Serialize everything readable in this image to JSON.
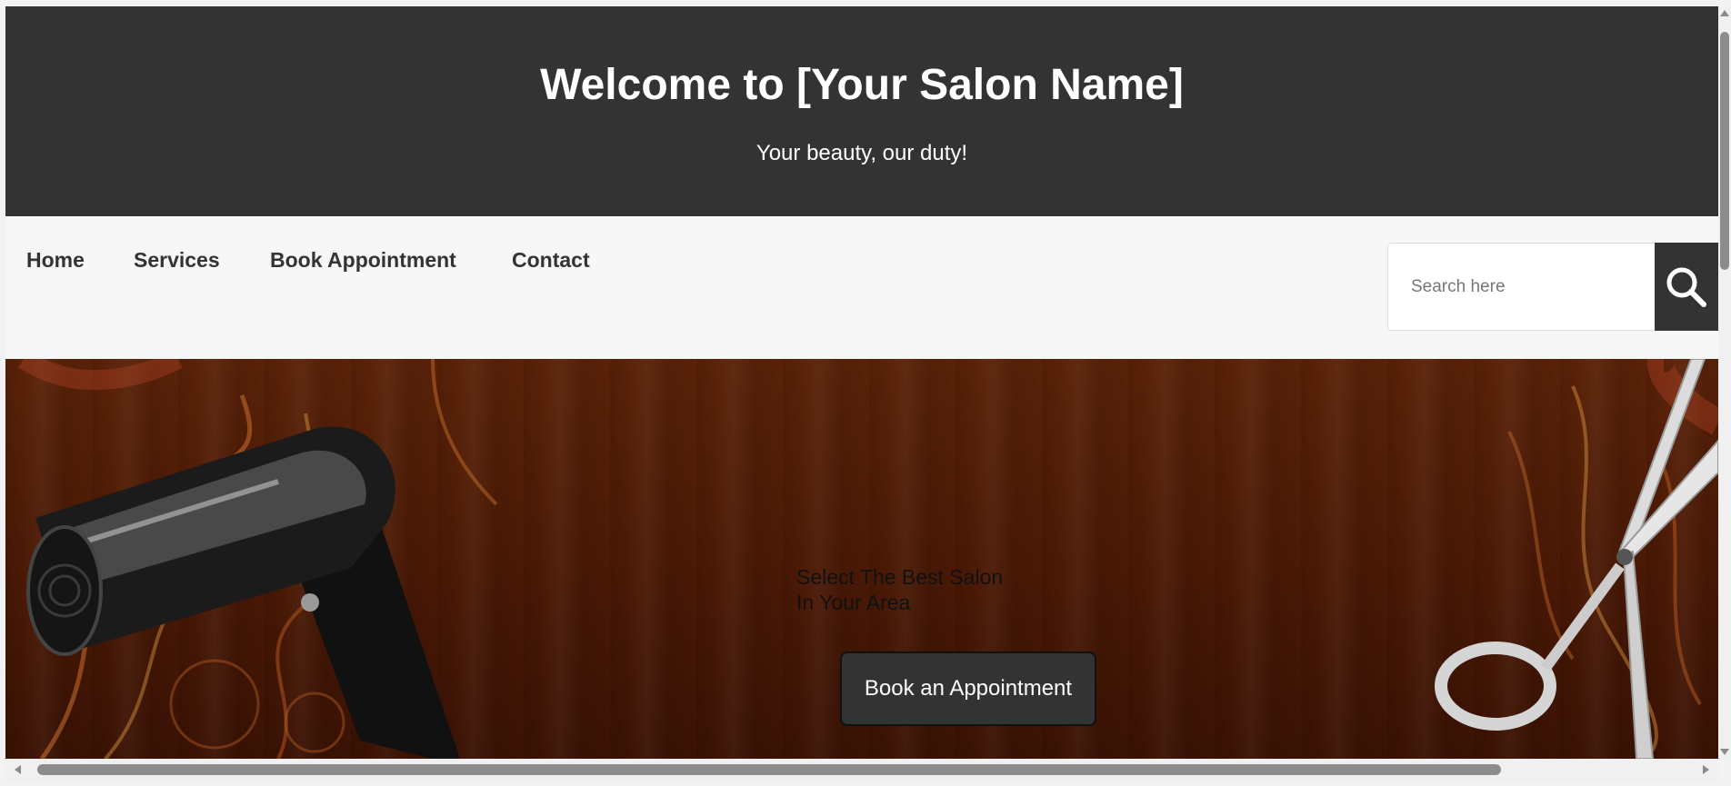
{
  "header": {
    "title": "Welcome to [Your Salon Name]",
    "tagline": "Your beauty, our duty!"
  },
  "nav": {
    "items": [
      {
        "label": "Home"
      },
      {
        "label": "Services"
      },
      {
        "label": "Book Appointment"
      },
      {
        "label": "Contact"
      }
    ]
  },
  "search": {
    "placeholder": "Search here",
    "value": "",
    "button_icon": "search-icon"
  },
  "hero": {
    "line1": "Select The Best Salon",
    "line2": "In Your Area",
    "button_label": "Book an Appointment",
    "left_image": "hair-dryer",
    "right_image": "scissors"
  },
  "colors": {
    "header_bg": "#333333",
    "nav_bg": "#f7f7f7",
    "hero_wood": "#4a1905",
    "button_bg": "#333333"
  }
}
